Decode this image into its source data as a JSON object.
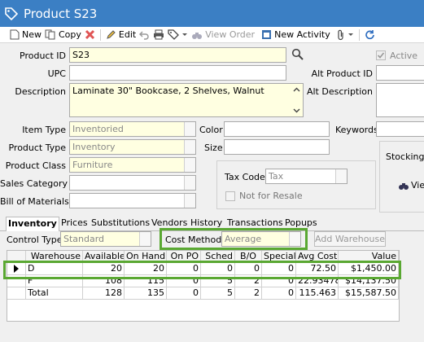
{
  "window": {
    "title": "Product S23"
  },
  "toolbar": {
    "new": "New",
    "copy": "Copy",
    "edit": "Edit",
    "view_order": "View Order",
    "new_activity": "New Activity"
  },
  "form": {
    "product_id_label": "Product ID",
    "product_id": "S23",
    "upc_label": "UPC",
    "upc": "",
    "description_label": "Description",
    "description": "Laminate 30\" Bookcase, 2 Shelves, Walnut",
    "active_label": "Active",
    "alt_product_id_label": "Alt Product ID",
    "alt_description_label": "Alt Description",
    "item_type_label": "Item Type",
    "item_type": "Inventoried",
    "product_type_label": "Product Type",
    "product_type": "Inventory",
    "product_class_label": "Product Class",
    "product_class": "Furniture",
    "sales_category_label": "Sales Category",
    "sales_category": "",
    "bom_label": "Bill of Materials",
    "bom": "",
    "color_label": "Color",
    "color": "",
    "size_label": "Size",
    "size": "",
    "keywords_label": "Keywords",
    "tax_code_label": "Tax Code",
    "tax_code": "Tax",
    "not_for_resale_label": "Not for Resale",
    "stocking_label": "Stocking U",
    "view_label": "Vie"
  },
  "tabs": [
    "Inventory",
    "Prices",
    "Substitutions",
    "Vendors",
    "History",
    "Transactions",
    "Popups"
  ],
  "inventory": {
    "control_type_label": "Control Type",
    "control_type": "Standard",
    "cost_method_label": "Cost Method",
    "cost_method": "Average",
    "add_warehouse": "Add Warehouse",
    "columns": [
      "Warehouse",
      "Available",
      "On Hand",
      "On PO",
      "Sched",
      "B/O",
      "Special",
      "Avg Cost",
      "Value"
    ],
    "rows": [
      [
        "D",
        "20",
        "20",
        "0",
        "0",
        "0",
        "0",
        "72.50",
        "$1,450.00"
      ],
      [
        "F",
        "108",
        "115",
        "0",
        "5",
        "2",
        "0",
        "22.93478",
        "$14,137.50"
      ],
      [
        "Total",
        "128",
        "135",
        "0",
        "5",
        "2",
        "0",
        "115.463",
        "$15,587.50"
      ]
    ]
  },
  "colors": {
    "titlebar": "#3b7fc4",
    "highlight": "#5aa832",
    "required_field": "#ffffe1"
  }
}
